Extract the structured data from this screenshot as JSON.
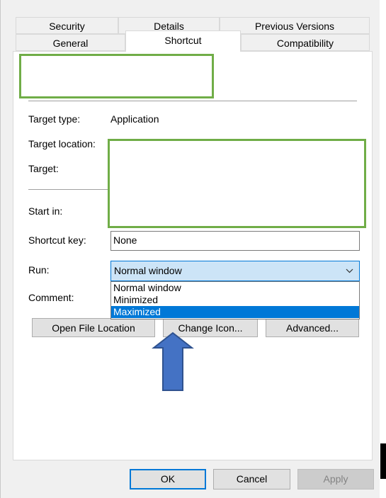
{
  "tabs_row1": [
    "Security",
    "Details",
    "Previous Versions"
  ],
  "tabs_row2": [
    "General",
    "Shortcut",
    "Compatibility"
  ],
  "fields": {
    "target_type_label": "Target type:",
    "target_type_value": "Application",
    "target_location_label": "Target location:",
    "target_label": "Target:",
    "start_in_label": "Start in:",
    "shortcut_key_label": "Shortcut key:",
    "shortcut_key_value": "None",
    "run_label": "Run:",
    "run_value": "Normal window",
    "comment_label": "Comment:"
  },
  "run_options": [
    "Normal window",
    "Minimized",
    "Maximized"
  ],
  "run_highlighted": "Maximized",
  "buttons": {
    "open_file_location": "Open File Location",
    "change_icon": "Change Icon...",
    "advanced": "Advanced...",
    "ok": "OK",
    "cancel": "Cancel",
    "apply": "Apply"
  },
  "colors": {
    "highlight_box": "#70ad47",
    "arrow": "#4472c4",
    "selection": "#0078d7"
  }
}
